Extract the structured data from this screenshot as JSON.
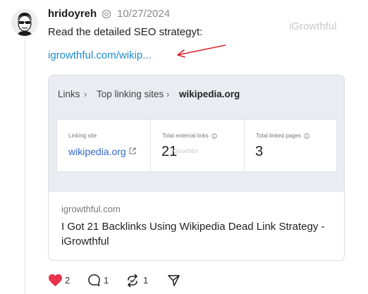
{
  "post": {
    "username": "hridoyreh",
    "timestamp": "10/27/2024",
    "watermark": "iGrowthful",
    "text": "Read the detailed SEO strategyt:",
    "link_text": "igrowthful.com/wikip..."
  },
  "card": {
    "breadcrumb": [
      "Links",
      "Top linking sites",
      "wikipedia.org"
    ],
    "stats": {
      "linking_site_label": "Linking site",
      "linking_site_value": "wikipedia.org",
      "external_label": "Total external links",
      "external_value": "21",
      "pages_label": "Total linked pages",
      "pages_value": "3",
      "mini_watermark": "iGrowthful"
    },
    "domain": "igrowthful.com",
    "title": "I Got 21 Backlinks Using Wikipedia Dead Link Strategy - iGrowthful"
  },
  "actions": {
    "likes": "2",
    "replies": "1",
    "reposts": "1"
  },
  "colors": {
    "like_heart": "#e8334a",
    "link": "#1f8ccf",
    "annotation_arrow": "#d9262e"
  },
  "icons": [
    "verified-badge-icon",
    "arrow-annotation-icon",
    "external-link-icon",
    "info-icon",
    "heart-icon",
    "comment-icon",
    "repost-icon",
    "share-icon"
  ]
}
